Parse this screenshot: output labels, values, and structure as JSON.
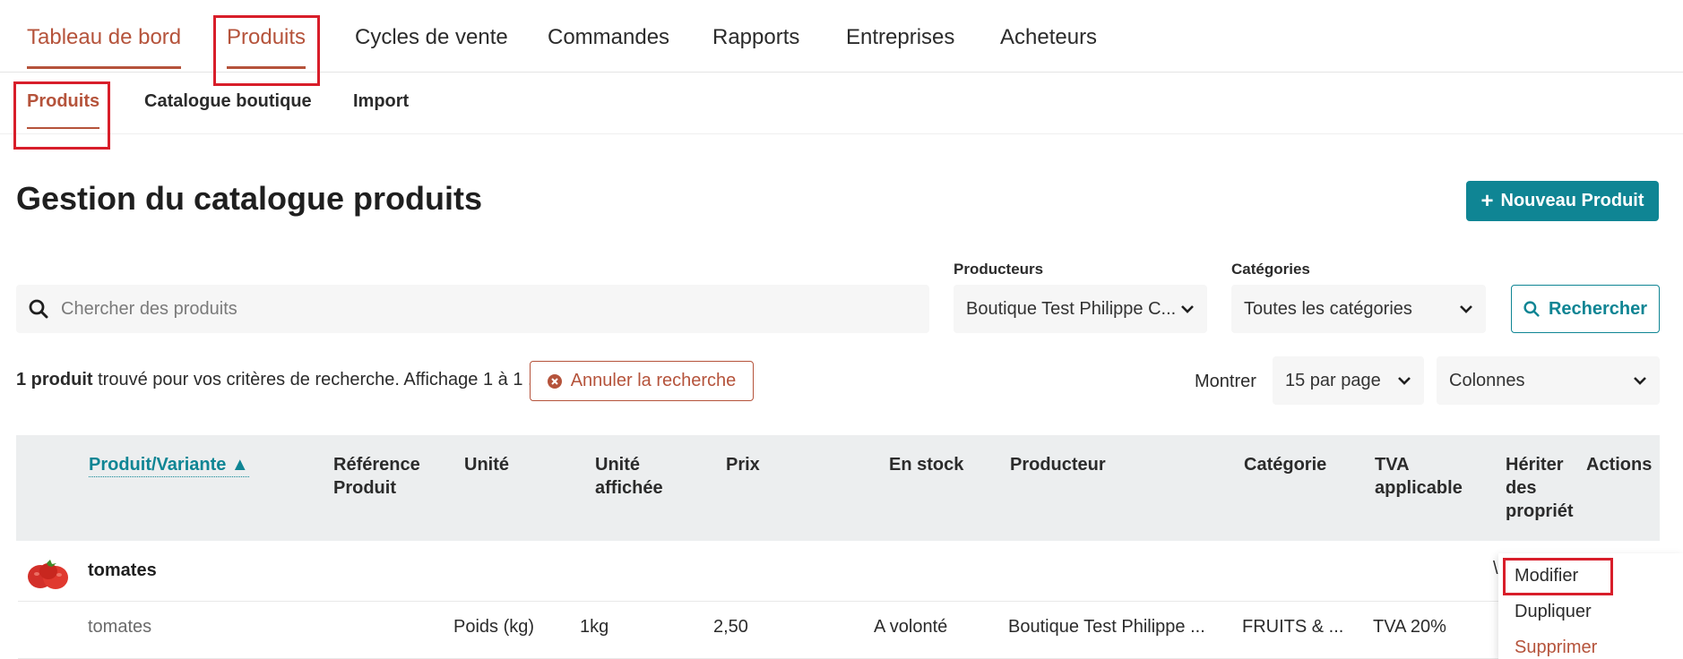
{
  "top_nav": {
    "tabs": [
      {
        "label": "Tableau de bord"
      },
      {
        "label": "Produits"
      },
      {
        "label": "Cycles de vente"
      },
      {
        "label": "Commandes"
      },
      {
        "label": "Rapports"
      },
      {
        "label": "Entreprises"
      },
      {
        "label": "Acheteurs"
      }
    ],
    "active_tab": "Produits"
  },
  "sub_nav": {
    "tabs": [
      {
        "label": "Produits"
      },
      {
        "label": "Catalogue boutique"
      },
      {
        "label": "Import"
      }
    ],
    "active_tab": "Produits"
  },
  "page": {
    "title": "Gestion du catalogue produits",
    "new_button_label": "Nouveau Produit"
  },
  "filters": {
    "search_placeholder": "Chercher des produits",
    "producers_label": "Producteurs",
    "producers_value": "Boutique Test Philippe C...",
    "categories_label": "Catégories",
    "categories_value": "Toutes les catégories",
    "search_button_label": "Rechercher"
  },
  "results": {
    "count_text": "1 produit",
    "summary_text": " trouvé pour vos critères de recherche. Affichage 1 à 1 .",
    "cancel_label": "Annuler la recherche",
    "show_label": "Montrer",
    "per_page_value": "15 par page",
    "columns_label": "Colonnes"
  },
  "table": {
    "headers": {
      "product": "Produit/Variante ▲",
      "reference_l1": "Référence",
      "reference_l2": "Produit",
      "unit": "Unité",
      "unit_display_l1": "Unité",
      "unit_display_l2": "affichée",
      "price": "Prix",
      "stock": "En stock",
      "producer": "Producteur",
      "category": "Catégorie",
      "vat_l1": "TVA",
      "vat_l2": "applicable",
      "inherit_l1": "Hériter",
      "inherit_l2": "des",
      "inherit_l3": "propriét",
      "actions": "Actions"
    },
    "product_row": {
      "name": "tomates",
      "partial_text": "\\"
    },
    "variant_row": {
      "name": "tomates",
      "unit": "Poids (kg)",
      "unit_display": "1kg",
      "price": "2,50",
      "stock": "A volonté",
      "producer": "Boutique Test Philippe ...",
      "category": "FRUITS & ...",
      "vat": "TVA 20%"
    }
  },
  "actions_menu": {
    "items": [
      {
        "label": "Modifier"
      },
      {
        "label": "Dupliquer"
      },
      {
        "label": "Supprimer"
      }
    ]
  },
  "colors": {
    "accent": "#b5533b",
    "teal": "#0f8594",
    "highlight": "#d81e2a"
  }
}
